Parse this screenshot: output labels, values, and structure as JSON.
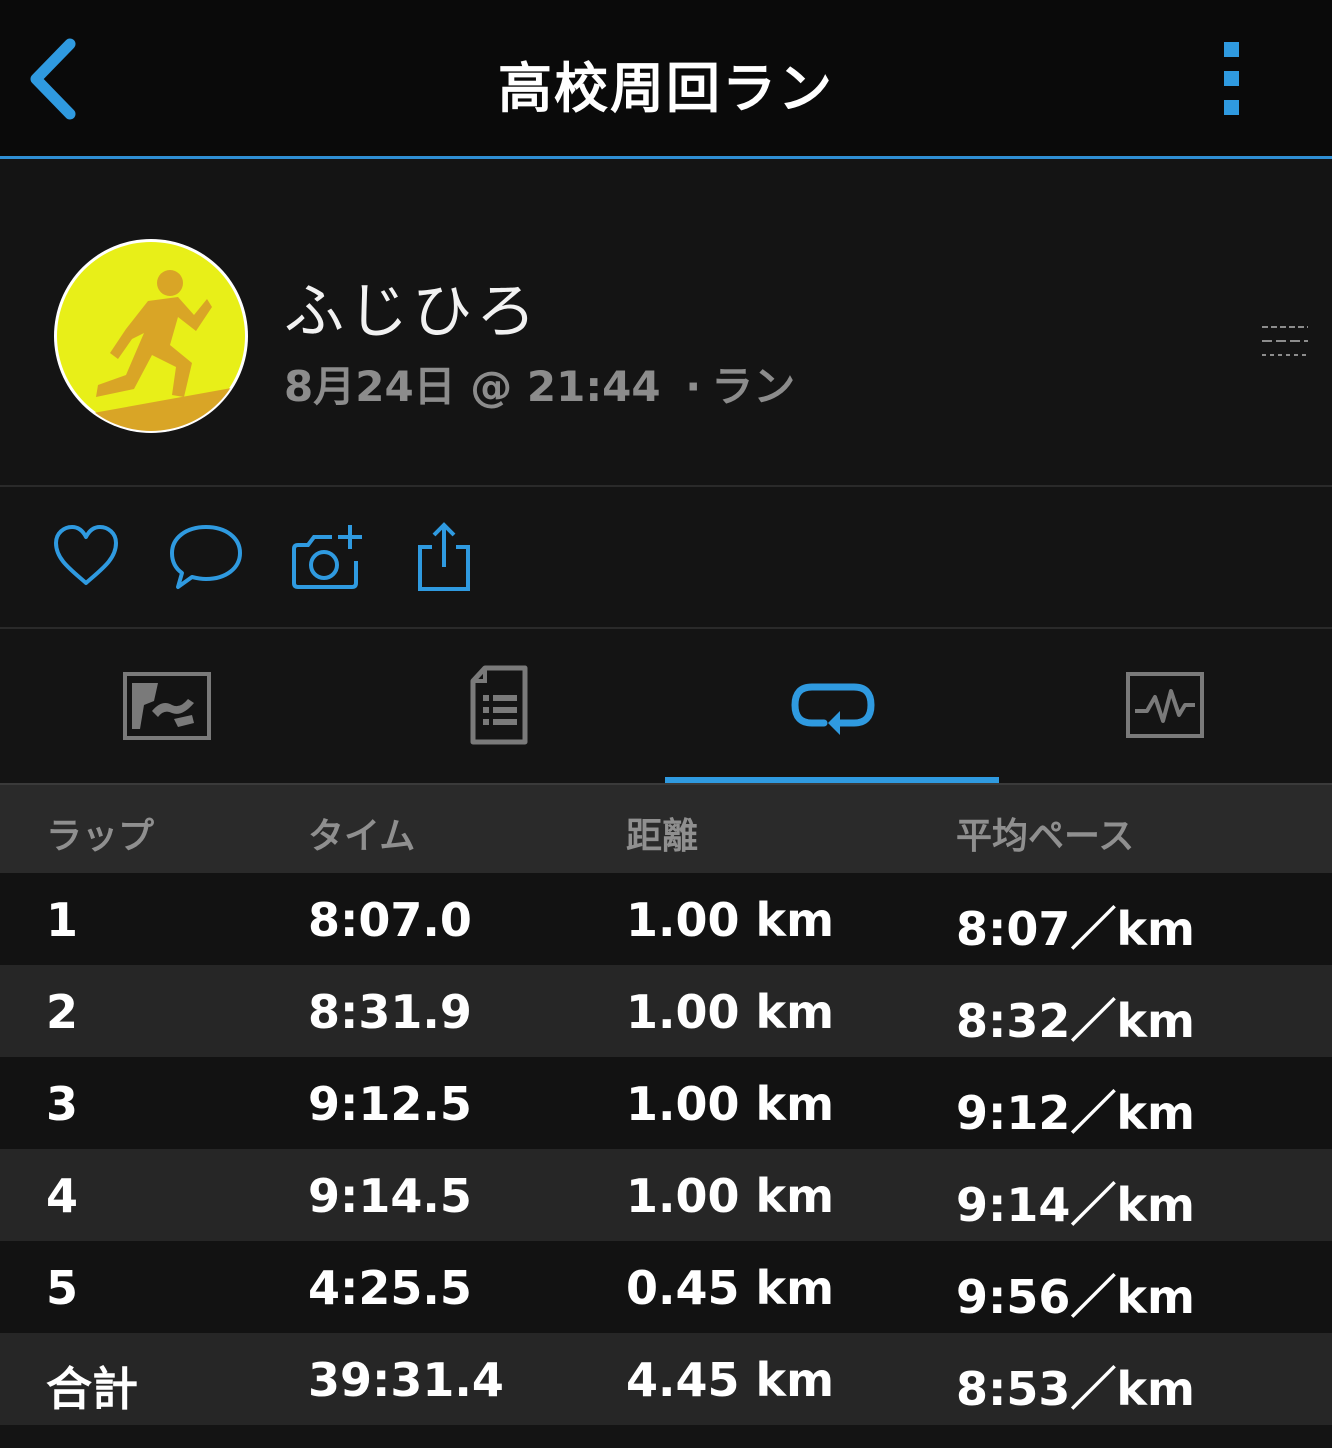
{
  "header": {
    "title": "高校周回ラン"
  },
  "profile": {
    "name": "ふじひろ",
    "date": "8月24日",
    "at": "@",
    "time": "21:44",
    "separator": "·",
    "activity_type": "ラン",
    "avatar_color": "#e8ef18"
  },
  "actions": [
    "heart-icon",
    "comment-icon",
    "add-photo-icon",
    "share-icon"
  ],
  "tabs": [
    {
      "icon": "map-icon",
      "active": false
    },
    {
      "icon": "document-list-icon",
      "active": false
    },
    {
      "icon": "laps-loop-icon",
      "active": true
    },
    {
      "icon": "chart-icon",
      "active": false
    }
  ],
  "laps": {
    "headers": {
      "lap": "ラップ",
      "time": "タイム",
      "distance": "距離",
      "avg_pace": "平均ペース"
    },
    "rows": [
      {
        "lap": "1",
        "time": "8:07.0",
        "distance": "1.00 km",
        "pace": "8:07／km"
      },
      {
        "lap": "2",
        "time": "8:31.9",
        "distance": "1.00 km",
        "pace": "8:32／km"
      },
      {
        "lap": "3",
        "time": "9:12.5",
        "distance": "1.00 km",
        "pace": "9:12／km"
      },
      {
        "lap": "4",
        "time": "9:14.5",
        "distance": "1.00 km",
        "pace": "9:14／km"
      },
      {
        "lap": "5",
        "time": "4:25.5",
        "distance": "0.45 km",
        "pace": "9:56／km"
      }
    ],
    "total": {
      "label": "合計",
      "time": "39:31.4",
      "distance": "4.45 km",
      "pace": "8:53／km"
    }
  },
  "colors": {
    "accent": "#2f9ae0",
    "background": "#141414"
  }
}
